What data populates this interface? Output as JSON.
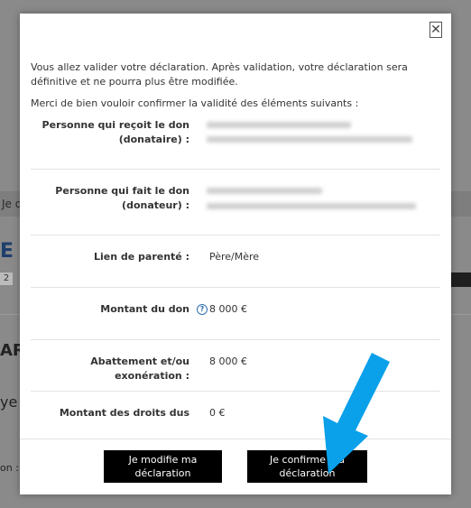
{
  "background": {
    "tab_fragment": "Je d",
    "title_fragment": "E D",
    "pill_number": "2",
    "section_fragment": "AR",
    "side_fragment": "ye",
    "side_fragment2": "on :"
  },
  "modal": {
    "close_symbol": "✕",
    "intro_text": "Vous allez valider votre déclaration. Après validation, votre déclaration sera définitive et ne pourra plus être modifiée.",
    "confirm_text": "Merci de bien vouloir confirmer la validité des éléments suivants :",
    "rows": [
      {
        "label_line1": "Personne qui reçoit le don",
        "label_line2": "(donataire) :"
      },
      {
        "label_line1": "Personne qui fait le don",
        "label_line2": "(donateur) :"
      },
      {
        "label": "Lien de parenté :",
        "value": "Père/Mère"
      },
      {
        "label": "Montant du don",
        "value": "8 000 €",
        "icon": "info-icon"
      },
      {
        "label": "Abattement et/ou exonération :",
        "value": "8 000 €"
      },
      {
        "label": "Montant des droits dus",
        "value": "0 €"
      }
    ],
    "buttons": {
      "modify_label": "Je modifie ma déclaration",
      "confirm_label": "Je confirme ma déclaration"
    }
  },
  "colors": {
    "arrow": "#0aa0ea",
    "button_bg": "#000000",
    "info_icon": "#2f6fb3"
  }
}
